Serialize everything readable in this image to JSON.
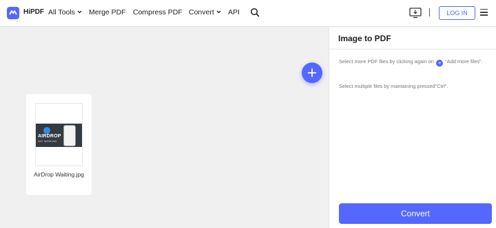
{
  "header": {
    "logo_text": "HiPDF",
    "nav": [
      {
        "label": "All Tools",
        "has_dropdown": true
      },
      {
        "label": "Merge PDF",
        "has_dropdown": false
      },
      {
        "label": "Compress PDF",
        "has_dropdown": false
      },
      {
        "label": "Convert",
        "has_dropdown": true
      },
      {
        "label": "API",
        "has_dropdown": false
      }
    ],
    "login_label": "LOG IN"
  },
  "files": [
    {
      "name": "AirDrop Waiting.jpg",
      "thumbnail": {
        "title": "AIRDROP",
        "subtitle": "NOT WORKING"
      }
    }
  ],
  "panel": {
    "title": "Image to PDF",
    "tip1_before": "Select more PDF files by clicking again on",
    "tip1_after": "\"Add more files\".",
    "tip2": "Select multiple files by mantaining pressed\"Ctrl\".",
    "convert_label": "Convert"
  },
  "colors": {
    "accent": "#5468ff",
    "background": "#f0f0f0"
  },
  "icons": {
    "logo": "hipdf-logo-icon",
    "search": "search-icon",
    "desktop": "desktop-download-icon",
    "menu": "hamburger-menu-icon",
    "add": "plus-icon"
  }
}
